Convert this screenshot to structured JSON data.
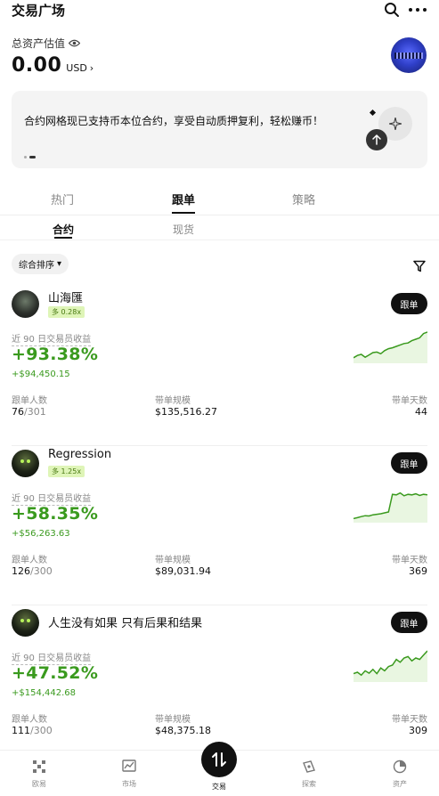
{
  "header": {
    "title": "交易广场",
    "search_icon": "search-icon",
    "more_icon": "more-horizontal-icon"
  },
  "assets": {
    "label": "总资产估值",
    "value": "0.00",
    "currency": "USD",
    "arrow": "›"
  },
  "banner": {
    "text": "合约网格现已支持币本位合约，享受自动质押复利，轻松赚币！",
    "slides": 2,
    "active_slide": 1
  },
  "tabs": [
    {
      "label": "热门",
      "active": false
    },
    {
      "label": "跟单",
      "active": true
    },
    {
      "label": "策略",
      "active": false
    }
  ],
  "subtabs": [
    {
      "label": "合约",
      "active": true
    },
    {
      "label": "现货",
      "active": false
    }
  ],
  "sort": {
    "label": "综合排序",
    "caret": "▾"
  },
  "cards": [
    {
      "name": "山海匯",
      "leverage": "多 0.28x",
      "follow_label": "跟单",
      "period_label": "近 90 日交易员收益",
      "pct": "+93.38%",
      "pnl": "+$94,450.15",
      "followers_label": "跟单人数",
      "followers": "76",
      "followers_max": "/301",
      "scale_label": "带单规模",
      "scale": "$135,516.27",
      "days_label": "带单天数",
      "days": "44",
      "spark": [
        0.1,
        0.18,
        0.22,
        0.12,
        0.2,
        0.28,
        0.3,
        0.24,
        0.35,
        0.42,
        0.45,
        0.5,
        0.55,
        0.6,
        0.62,
        0.7,
        0.75,
        0.8,
        0.95,
        1.0
      ]
    },
    {
      "name": "Regression",
      "leverage": "多 1.25x",
      "follow_label": "跟单",
      "period_label": "近 90 日交易员收益",
      "pct": "+58.35%",
      "pnl": "+$56,263.63",
      "followers_label": "跟单人数",
      "followers": "126",
      "followers_max": "/300",
      "scale_label": "带单规模",
      "scale": "$89,031.94",
      "days_label": "带单天数",
      "days": "369",
      "spark": [
        0.05,
        0.08,
        0.12,
        0.15,
        0.14,
        0.18,
        0.2,
        0.22,
        0.25,
        0.28,
        0.9,
        0.88,
        0.95,
        0.85,
        0.9,
        0.88,
        0.92,
        0.86,
        0.9,
        0.88
      ]
    },
    {
      "name": "人生没有如果 只有后果和结果",
      "leverage": "",
      "follow_label": "跟单",
      "period_label": "近 90 日交易员收益",
      "pct": "+47.52%",
      "pnl": "+$154,442.68",
      "followers_label": "跟单人数",
      "followers": "111",
      "followers_max": "/300",
      "scale_label": "带单规模",
      "scale": "$48,375.18",
      "days_label": "带单天数",
      "days": "309",
      "spark": [
        0.2,
        0.25,
        0.15,
        0.3,
        0.22,
        0.35,
        0.2,
        0.4,
        0.3,
        0.45,
        0.5,
        0.7,
        0.6,
        0.75,
        0.8,
        0.65,
        0.75,
        0.7,
        0.85,
        1.0
      ]
    }
  ],
  "nav": [
    {
      "label": "欧易",
      "icon": "okx-logo-icon",
      "active": false
    },
    {
      "label": "市场",
      "icon": "market-chart-icon",
      "active": false
    },
    {
      "label": "交易",
      "icon": "trade-swap-icon",
      "active": true
    },
    {
      "label": "探索",
      "icon": "explore-compass-icon",
      "active": false
    },
    {
      "label": "资产",
      "icon": "assets-pie-icon",
      "active": false
    }
  ],
  "colors": {
    "accent_green": "#3a9a1e",
    "chip_bg": "#dff5b8",
    "chip_text": "#4a7a12",
    "button_dark": "#111111"
  }
}
